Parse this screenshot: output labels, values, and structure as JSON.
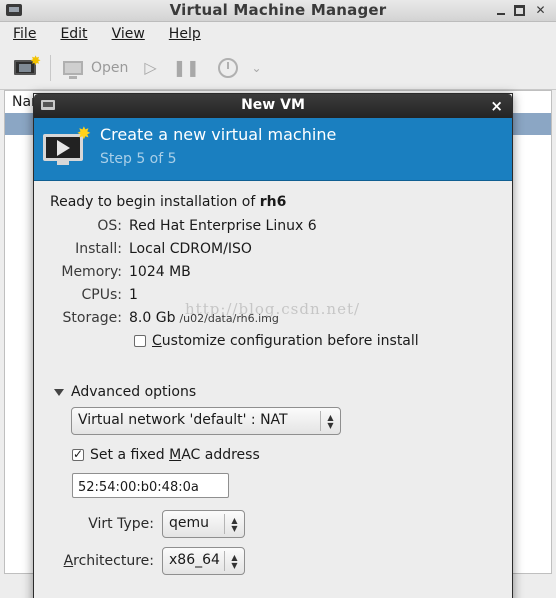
{
  "main": {
    "title": "Virtual Machine Manager",
    "menus": [
      "File",
      "Edit",
      "View",
      "Help"
    ],
    "toolbar": {
      "open_label": "Open"
    },
    "list_header": "Nar"
  },
  "dialog": {
    "title": "New VM",
    "banner": {
      "heading": "Create a new virtual machine",
      "step": "Step 5 of 5"
    },
    "ready_prefix": "Ready to begin installation of ",
    "vm_name": "rh6",
    "details": {
      "os_label": "OS:",
      "os_value": "Red Hat Enterprise Linux 6",
      "install_label": "Install:",
      "install_value": "Local CDROM/ISO",
      "memory_label": "Memory:",
      "memory_value": "1024 MB",
      "cpus_label": "CPUs:",
      "cpus_value": "1",
      "storage_label": "Storage:",
      "storage_value": "8.0 Gb",
      "storage_path": "/u02/data/rh6.img"
    },
    "customize": {
      "label_first": "C",
      "label_rest": "ustomize configuration before install",
      "checked": false
    },
    "advanced": {
      "label": "Advanced options",
      "network": "Virtual network 'default' : NAT",
      "mac": {
        "label_pre": "Set a fixed ",
        "label_u": "M",
        "label_post": "AC address",
        "checked": true,
        "value": "52:54:00:b0:48:0a"
      },
      "virt_type_label": "Virt Type:",
      "virt_type": "qemu",
      "arch_label_u": "A",
      "arch_label_rest": "rchitecture:",
      "arch": "x86_64"
    }
  },
  "watermark": "http://blog.csdn.net/"
}
